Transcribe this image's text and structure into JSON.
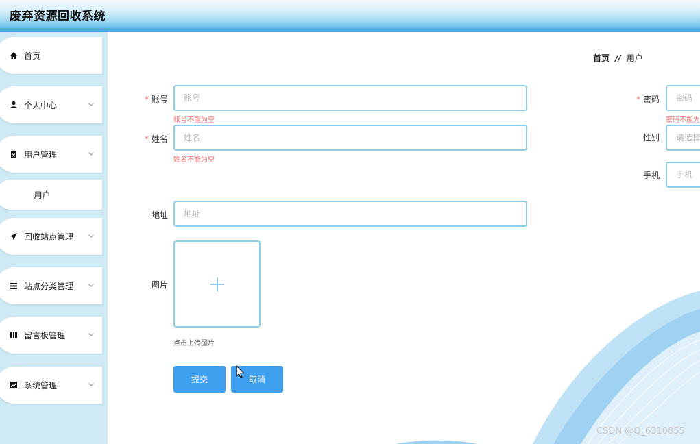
{
  "app": {
    "title": "废弃资源回收系统"
  },
  "sidebar": {
    "items": [
      {
        "label": "首页",
        "icon": "home-icon"
      },
      {
        "label": "个人中心",
        "icon": "user-icon"
      },
      {
        "label": "用户管理",
        "icon": "clipboard-icon"
      },
      {
        "label": "回收站点管理",
        "icon": "paper-plane-icon"
      },
      {
        "label": "站点分类管理",
        "icon": "list-icon"
      },
      {
        "label": "留言板管理",
        "icon": "book-icon"
      },
      {
        "label": "系统管理",
        "icon": "chart-line-icon"
      }
    ],
    "sub_item": "用户"
  },
  "breadcrumb": {
    "home": "首页",
    "sep": "//",
    "current": "用户"
  },
  "form": {
    "account": {
      "label": "账号",
      "placeholder": "账号",
      "error": "账号不能为空",
      "required": true
    },
    "password": {
      "label": "密码",
      "placeholder": "密码",
      "error": "密码不能为空",
      "required": true
    },
    "name": {
      "label": "姓名",
      "placeholder": "姓名",
      "error": "姓名不能为空",
      "required": true
    },
    "gender": {
      "label": "性别",
      "placeholder": "请选择性别"
    },
    "phone": {
      "label": "手机",
      "placeholder": "手机"
    },
    "address": {
      "label": "地址",
      "placeholder": "地址"
    },
    "image": {
      "label": "图片",
      "tip": "点击上传图片"
    }
  },
  "buttons": {
    "submit": "提交",
    "cancel": "取消"
  },
  "watermark": "CSDN @Q_6310855",
  "colors": {
    "accent": "#3fa0f0",
    "border": "#8ccfe8",
    "error": "#f56c6c",
    "sidebar_bg": "#cfe9f5"
  }
}
